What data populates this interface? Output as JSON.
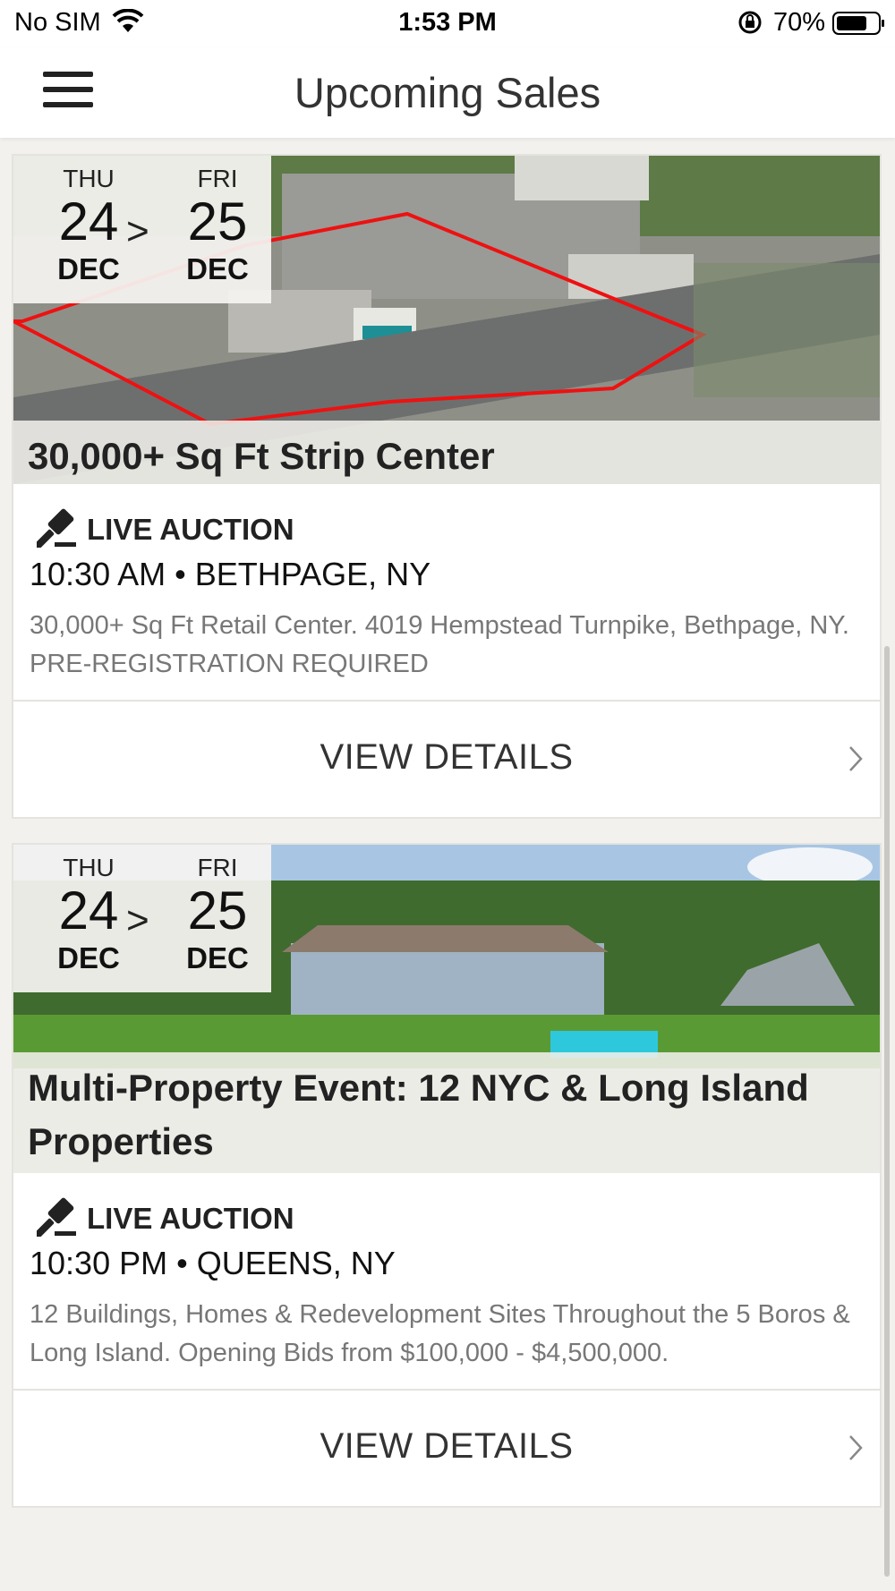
{
  "status_bar": {
    "carrier": "No SIM",
    "time": "1:53 PM",
    "battery_percent": "70%",
    "icons": [
      "wifi-icon",
      "orientation-lock-icon",
      "battery-icon"
    ]
  },
  "nav": {
    "title": "Upcoming Sales",
    "menu_icon": "hamburger-menu-icon"
  },
  "sales": [
    {
      "start": {
        "dow": "THU",
        "day": "24",
        "month": "DEC"
      },
      "end": {
        "dow": "FRI",
        "day": "25",
        "month": "DEC"
      },
      "arrow": ">",
      "title": "30,000+ Sq Ft Strip Center",
      "auction_type": "LIVE AUCTION",
      "time_location": "10:30 AM • BETHPAGE, NY",
      "description": "30,000+ Sq Ft Retail Center. 4019 Hempstead Turnpike, Bethpage, NY. PRE-REGISTRATION REQUIRED",
      "cta": "VIEW DETAILS"
    },
    {
      "start": {
        "dow": "THU",
        "day": "24",
        "month": "DEC"
      },
      "end": {
        "dow": "FRI",
        "day": "25",
        "month": "DEC"
      },
      "arrow": ">",
      "title": "Multi-Property Event: 12 NYC & Long Island Properties",
      "auction_type": "LIVE AUCTION",
      "time_location": "10:30 PM • QUEENS, NY",
      "description": "12 Buildings, Homes & Redevelopment Sites Throughout the 5 Boros & Long Island. Opening Bids from $100,000 - $4,500,000.",
      "cta": "VIEW DETAILS"
    }
  ]
}
